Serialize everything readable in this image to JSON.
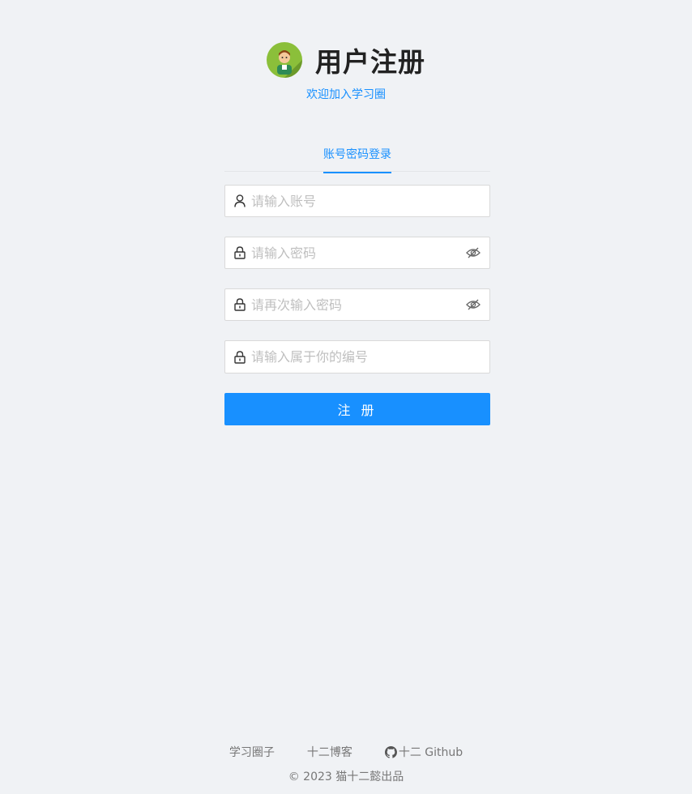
{
  "header": {
    "title": "用户注册",
    "subtitle": "欢迎加入学习圈"
  },
  "tabs": [
    {
      "label": "账号密码登录",
      "active": true
    }
  ],
  "form": {
    "account_placeholder": "请输入账号",
    "password_placeholder": "请输入密码",
    "confirm_password_placeholder": "请再次输入密码",
    "code_placeholder": "请输入属于你的编号",
    "submit_label": "注 册"
  },
  "footer": {
    "links": [
      {
        "label": "学习圈子"
      },
      {
        "label": "十二博客"
      },
      {
        "label": "十二 Github",
        "icon": "github-icon"
      }
    ],
    "copyright": "2023 猫十二懿出品"
  },
  "colors": {
    "accent": "#1890ff",
    "background": "#f0f2f5",
    "logo_bg": "#8bbf3a"
  }
}
